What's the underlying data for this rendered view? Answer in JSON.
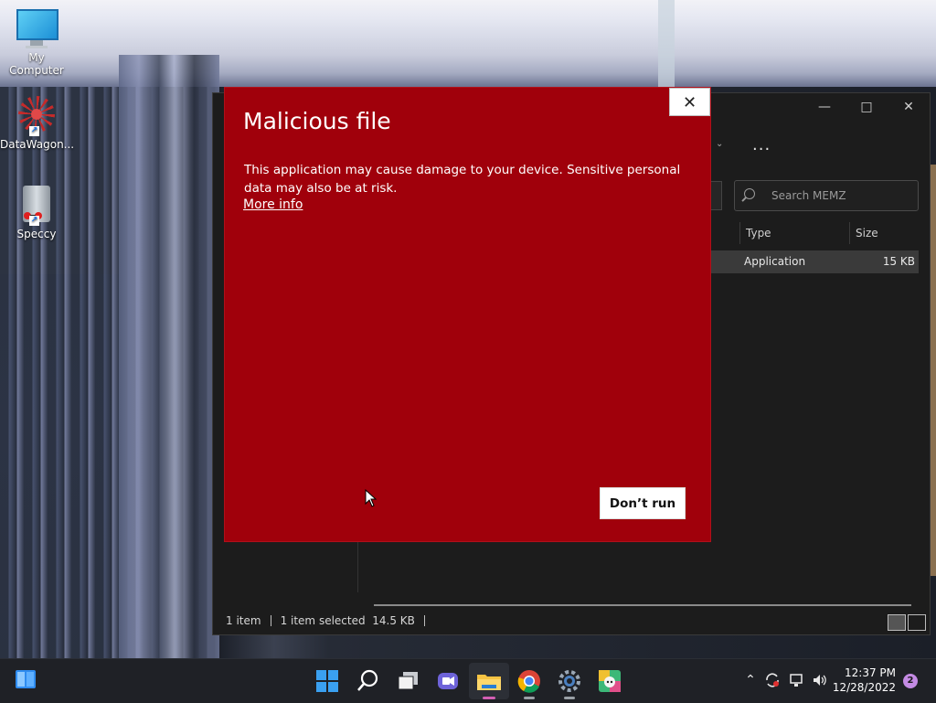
{
  "desktop": {
    "icons": [
      {
        "label": "My Computer"
      },
      {
        "label": "DataWagon..."
      },
      {
        "label": "Speccy"
      }
    ]
  },
  "explorer": {
    "search_placeholder": "Search MEMZ",
    "columns": [
      "Type",
      "Size"
    ],
    "row": {
      "type": "Application",
      "size": "15 KB"
    },
    "status": {
      "items": "1 item",
      "selected": "1 item selected",
      "size": "14.5 KB"
    },
    "more_label": "..."
  },
  "dialog": {
    "title": "Malicious file",
    "message": "This application may cause damage to your device. Sensitive personal data may also be at risk.",
    "more_info": "More info",
    "dont_run": "Don’t run",
    "accent_color": "#a0000b"
  },
  "taskbar": {
    "time": "12:37 PM",
    "date": "12/28/2022",
    "notification_count": "2"
  }
}
